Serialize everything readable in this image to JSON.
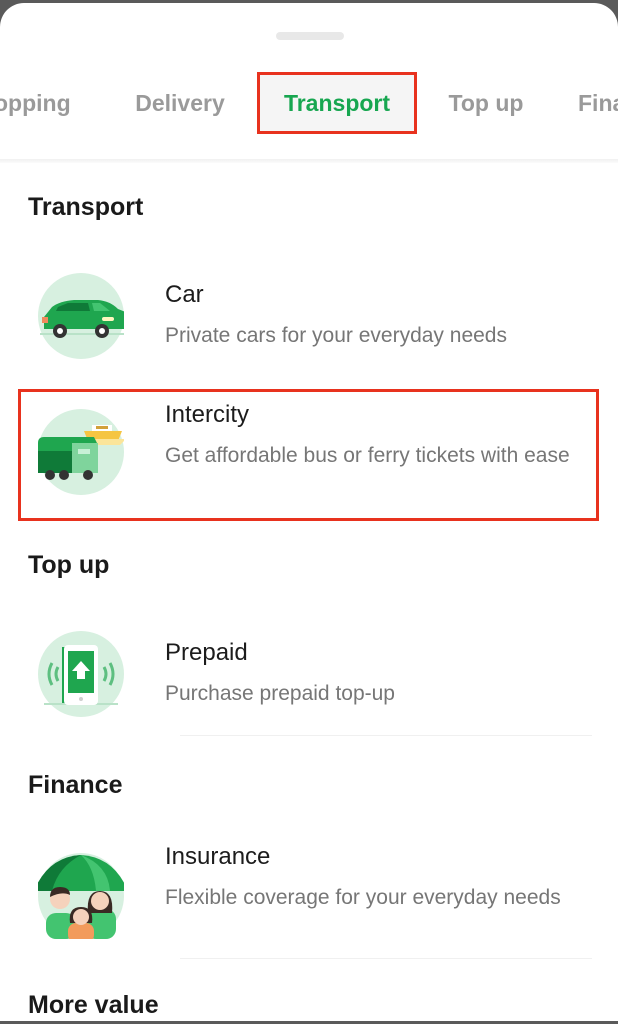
{
  "tabs": [
    {
      "label": "Shopping",
      "visible_text": "opping",
      "active": false
    },
    {
      "label": "Delivery",
      "active": false
    },
    {
      "label": "Transport",
      "active": true
    },
    {
      "label": "Top up",
      "active": false
    },
    {
      "label": "Finance",
      "visible_text": "Fina",
      "active": false
    }
  ],
  "colors": {
    "accent": "#17a650",
    "highlight_box": "#e8321e",
    "icon_bg": "#d7f0e0"
  },
  "sections": [
    {
      "title": "Transport",
      "items": [
        {
          "title": "Car",
          "description": "Private cars for your everyday needs",
          "icon": "car-icon"
        },
        {
          "title": "Intercity",
          "description": "Get affordable bus or ferry tickets with ease",
          "icon": "bus-ferry-icon",
          "highlighted": true
        }
      ]
    },
    {
      "title": "Top up",
      "items": [
        {
          "title": "Prepaid",
          "description": "Purchase prepaid top-up",
          "icon": "phone-topup-icon"
        }
      ]
    },
    {
      "title": "Finance",
      "items": [
        {
          "title": "Insurance",
          "description": "Flexible coverage for your everyday needs",
          "icon": "umbrella-family-icon"
        }
      ]
    },
    {
      "title": "More value",
      "items": []
    }
  ]
}
